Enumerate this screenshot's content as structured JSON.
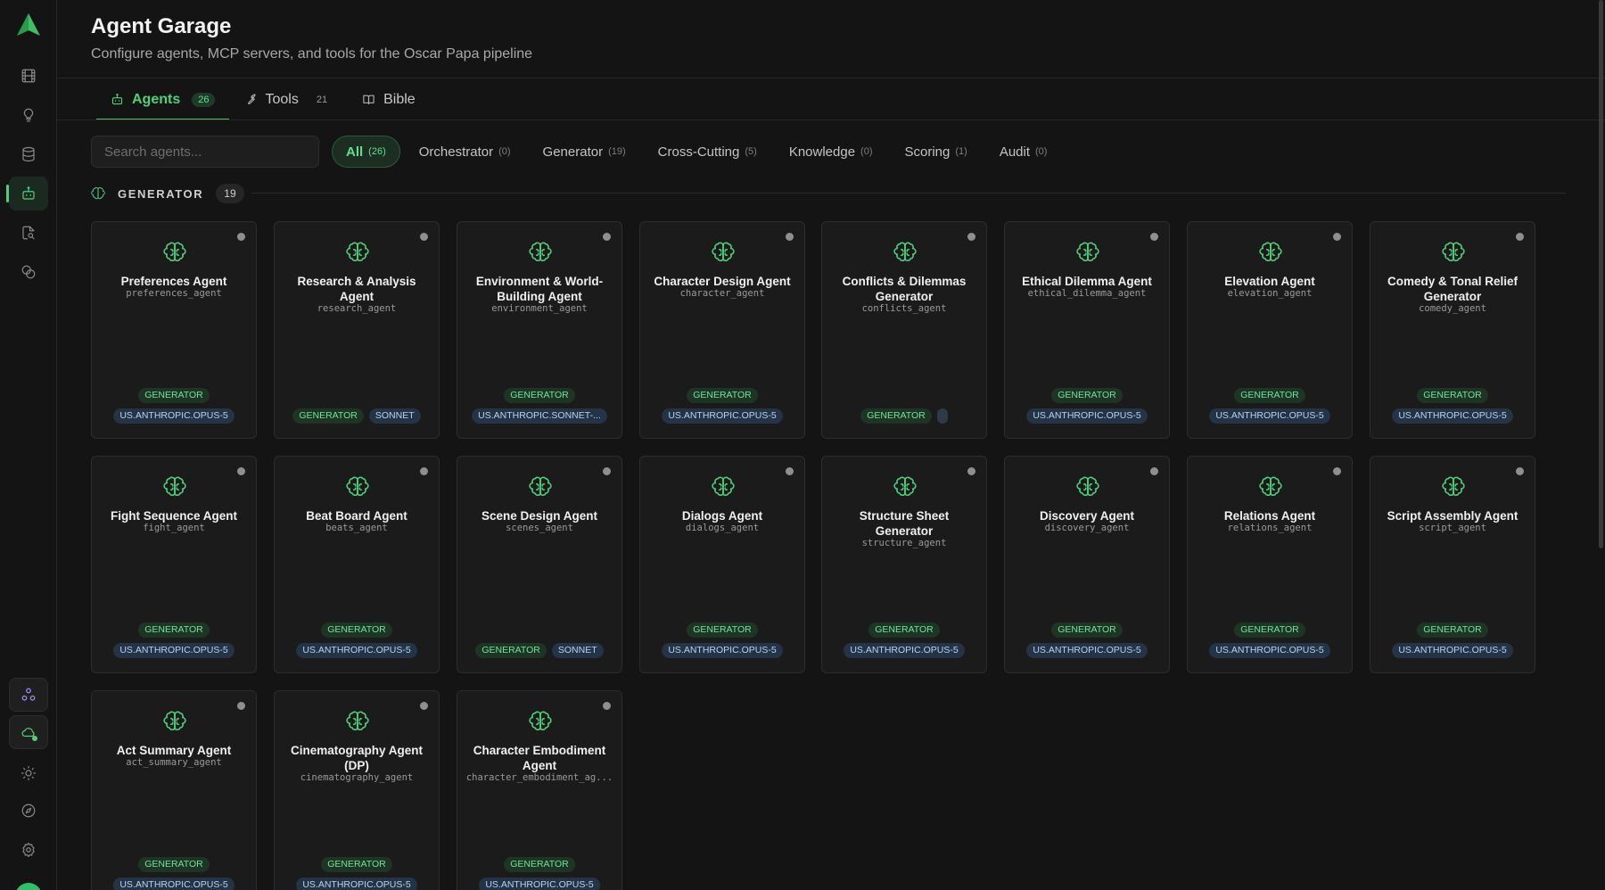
{
  "header": {
    "title": "Agent Garage",
    "subtitle": "Configure agents, MCP servers, and tools for the Oscar Papa pipeline"
  },
  "tabs": [
    {
      "label": "Agents",
      "count": "26",
      "icon": "robot-icon"
    },
    {
      "label": "Tools",
      "count": "21",
      "icon": "wrench-icon"
    },
    {
      "label": "Bible",
      "count": "",
      "icon": "book-icon"
    }
  ],
  "search": {
    "placeholder": "Search agents..."
  },
  "filters": [
    {
      "label": "All",
      "count": "(26)"
    },
    {
      "label": "Orchestrator",
      "count": "(0)"
    },
    {
      "label": "Generator",
      "count": "(19)"
    },
    {
      "label": "Cross-Cutting",
      "count": "(5)"
    },
    {
      "label": "Knowledge",
      "count": "(0)"
    },
    {
      "label": "Scoring",
      "count": "(1)"
    },
    {
      "label": "Audit",
      "count": "(0)"
    }
  ],
  "section": {
    "title": "GENERATOR",
    "count": "19"
  },
  "agents": [
    {
      "name": "Preferences Agent",
      "id": "preferences_agent",
      "tags1": [
        "GENERATOR"
      ],
      "tags2": [
        "US.ANTHROPIC.OPUS-5"
      ]
    },
    {
      "name": "Research & Analysis Agent",
      "id": "research_agent",
      "tags1": [],
      "tags2": [
        "GENERATOR",
        "SONNET"
      ]
    },
    {
      "name": "Environment & World-Building Agent",
      "id": "environment_agent",
      "tags1": [
        "GENERATOR"
      ],
      "tags2": [
        "US.ANTHROPIC.SONNET-..."
      ]
    },
    {
      "name": "Character Design Agent",
      "id": "character_agent",
      "tags1": [
        "GENERATOR"
      ],
      "tags2": [
        "US.ANTHROPIC.OPUS-5"
      ]
    },
    {
      "name": "Conflicts & Dilemmas Generator",
      "id": "conflicts_agent",
      "tags1": [],
      "tags2": [
        "GENERATOR",
        ""
      ]
    },
    {
      "name": "Ethical Dilemma Agent",
      "id": "ethical_dilemma_agent",
      "tags1": [
        "GENERATOR"
      ],
      "tags2": [
        "US.ANTHROPIC.OPUS-5"
      ]
    },
    {
      "name": "Elevation Agent",
      "id": "elevation_agent",
      "tags1": [
        "GENERATOR"
      ],
      "tags2": [
        "US.ANTHROPIC.OPUS-5"
      ]
    },
    {
      "name": "Comedy & Tonal Relief Generator",
      "id": "comedy_agent",
      "tags1": [
        "GENERATOR"
      ],
      "tags2": [
        "US.ANTHROPIC.OPUS-5"
      ]
    },
    {
      "name": "Fight Sequence Agent",
      "id": "fight_agent",
      "tags1": [
        "GENERATOR"
      ],
      "tags2": [
        "US.ANTHROPIC.OPUS-5"
      ]
    },
    {
      "name": "Beat Board Agent",
      "id": "beats_agent",
      "tags1": [
        "GENERATOR"
      ],
      "tags2": [
        "US.ANTHROPIC.OPUS-5"
      ]
    },
    {
      "name": "Scene Design Agent",
      "id": "scenes_agent",
      "tags1": [],
      "tags2": [
        "GENERATOR",
        "SONNET"
      ]
    },
    {
      "name": "Dialogs Agent",
      "id": "dialogs_agent",
      "tags1": [
        "GENERATOR"
      ],
      "tags2": [
        "US.ANTHROPIC.OPUS-5"
      ]
    },
    {
      "name": "Structure Sheet Generator",
      "id": "structure_agent",
      "tags1": [
        "GENERATOR"
      ],
      "tags2": [
        "US.ANTHROPIC.OPUS-5"
      ]
    },
    {
      "name": "Discovery Agent",
      "id": "discovery_agent",
      "tags1": [
        "GENERATOR"
      ],
      "tags2": [
        "US.ANTHROPIC.OPUS-5"
      ]
    },
    {
      "name": "Relations Agent",
      "id": "relations_agent",
      "tags1": [
        "GENERATOR"
      ],
      "tags2": [
        "US.ANTHROPIC.OPUS-5"
      ]
    },
    {
      "name": "Script Assembly Agent",
      "id": "script_agent",
      "tags1": [
        "GENERATOR"
      ],
      "tags2": [
        "US.ANTHROPIC.OPUS-5"
      ]
    },
    {
      "name": "Act Summary Agent",
      "id": "act_summary_agent",
      "tags1": [
        "GENERATOR"
      ],
      "tags2": [
        "US.ANTHROPIC.OPUS-5"
      ]
    },
    {
      "name": "Cinematography Agent (DP)",
      "id": "cinematography_agent",
      "tags1": [
        "GENERATOR"
      ],
      "tags2": [
        "US.ANTHROPIC.OPUS-5"
      ]
    },
    {
      "name": "Character Embodiment Agent",
      "id": "character_embodiment_ag...",
      "tags1": [
        "GENERATOR"
      ],
      "tags2": [
        "US.ANTHROPIC.OPUS-5"
      ]
    }
  ],
  "sidebar": {
    "items": [
      {
        "name": "film-icon"
      },
      {
        "name": "lightbulb-icon"
      },
      {
        "name": "database-icon"
      },
      {
        "name": "robot-icon",
        "active": true
      },
      {
        "name": "document-search-icon"
      },
      {
        "name": "coins-icon"
      },
      {
        "name": "triangle-nodes-icon"
      },
      {
        "name": "cloud-icon"
      },
      {
        "name": "sun-icon"
      },
      {
        "name": "compass-icon"
      },
      {
        "name": "gear-icon"
      }
    ]
  },
  "colors": {
    "accent": "#4fd17a",
    "background": "#141414",
    "card": "#1b1b1b",
    "model_tag": "#243346"
  }
}
